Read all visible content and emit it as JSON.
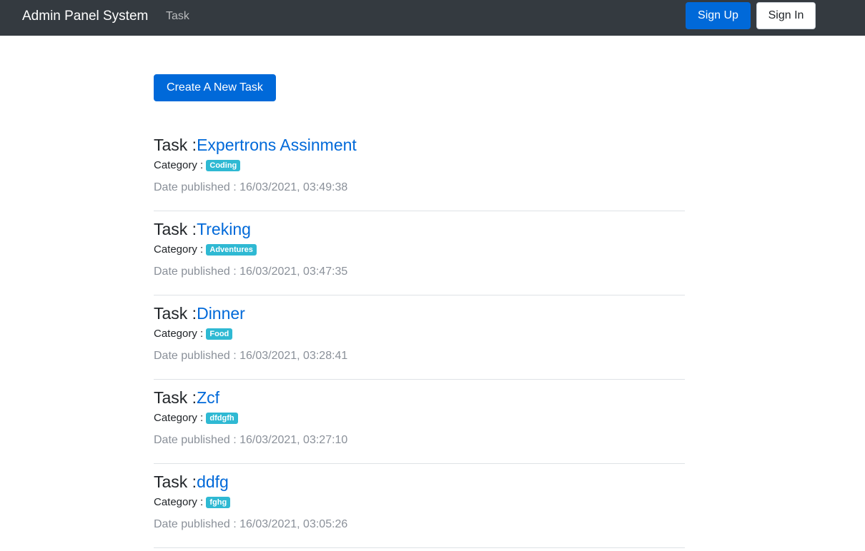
{
  "navbar": {
    "brand": "Admin Panel System",
    "link": "Task",
    "signup_label": "Sign Up",
    "signin_label": "Sign In"
  },
  "main": {
    "create_label": "Create A New Task",
    "task_prefix": "Task :",
    "category_prefix": "Category : ",
    "date_prefix": "Date published : ",
    "tasks": [
      {
        "title": "Expertrons Assinment",
        "category": "Coding",
        "date": "16/03/2021, 03:49:38"
      },
      {
        "title": "Treking",
        "category": "Adventures",
        "date": "16/03/2021, 03:47:35"
      },
      {
        "title": "Dinner",
        "category": "Food",
        "date": "16/03/2021, 03:28:41"
      },
      {
        "title": "Zcf",
        "category": "dfdgfh",
        "date": "16/03/2021, 03:27:10"
      },
      {
        "title": "ddfg",
        "category": "fghg",
        "date": "16/03/2021, 03:05:26"
      }
    ]
  },
  "colors": {
    "navbar_bg": "#343a40",
    "primary": "#0069d9",
    "badge": "#2fb9d3",
    "muted": "#8a9099"
  }
}
